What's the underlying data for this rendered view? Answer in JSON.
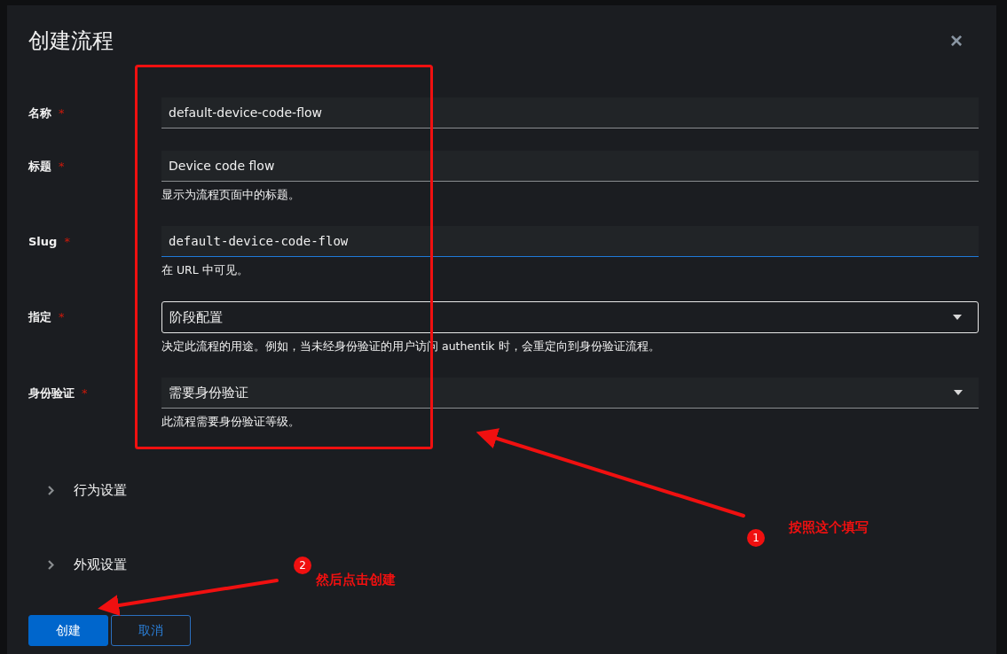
{
  "dialog": {
    "title": "创建流程",
    "close": "×"
  },
  "fields": [
    {
      "kind": "text",
      "label": "名称",
      "mark": "*",
      "value": "default-device-code-flow",
      "focused": false
    },
    {
      "kind": "text",
      "label": "标题",
      "mark": "*",
      "value": "Device code flow",
      "help": "显示为流程页面中的标题。",
      "focused": false
    },
    {
      "kind": "code",
      "label": "Slug",
      "mark": "*",
      "value": "default-device-code-flow",
      "help": "在 URL 中可见。",
      "focused": true
    },
    {
      "kind": "select",
      "label": "指定",
      "mark": "*",
      "value": "阶段配置",
      "help": "决定此流程的用途。例如，当未经身份验证的用户访问 authentik 时，会重定向到身份验证流程。",
      "focused": true
    },
    {
      "kind": "select",
      "label": "身份验证",
      "mark": "*",
      "value": "需要身份验证",
      "help": "此流程需要身份验证等级。",
      "focused": false
    }
  ],
  "sections": [
    {
      "label": "行为设置",
      "expanded": false
    },
    {
      "label": "外观设置",
      "expanded": false
    }
  ],
  "buttons": [
    {
      "kind": "primary",
      "label": "创建"
    },
    {
      "kind": "secondary",
      "label": "取消"
    }
  ],
  "annotations": [
    {
      "number": "1",
      "text": "按照这个填写"
    },
    {
      "number": "2",
      "text": "然后点击创建"
    }
  ]
}
